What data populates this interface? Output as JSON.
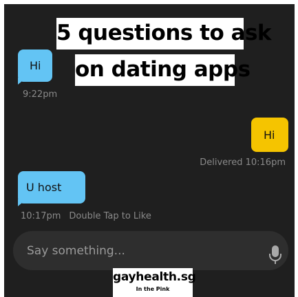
{
  "banner": {
    "line1": "5 questions to ask",
    "line2": "on dating apps"
  },
  "messages": [
    {
      "direction": "incoming",
      "text": "Hi",
      "meta": "9:22pm"
    },
    {
      "direction": "outgoing",
      "text": "Hi",
      "meta": "Delivered 10:16pm"
    },
    {
      "direction": "incoming",
      "text": "U host",
      "meta_time": "10:17pm",
      "meta_hint": "Double Tap to Like"
    }
  ],
  "composer": {
    "placeholder": "Say something...",
    "mic_icon": "microphone-icon"
  },
  "watermark": {
    "brand": "gayhealth.sg",
    "tagline": "In the Pink"
  },
  "colors": {
    "background": "#1f1f1f",
    "incoming_bubble": "#63c4f4",
    "outgoing_bubble": "#f5c400",
    "input_bar": "#2e2e2e",
    "meta_text": "#8a8a8a"
  }
}
